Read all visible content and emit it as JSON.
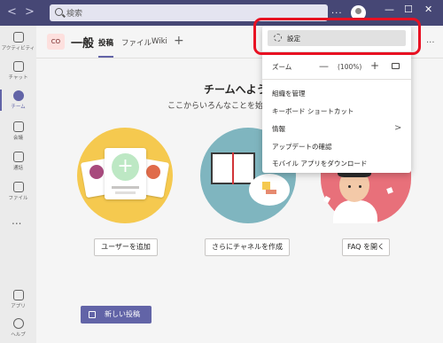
{
  "titlebar": {
    "back": "<",
    "forward": ">",
    "search_placeholder": "検索",
    "more": "...",
    "window_minimize": "—",
    "window_maximize": "☐",
    "window_close": "✕"
  },
  "rail": {
    "items": [
      {
        "label": "アクティビティ",
        "icon": "bell-icon"
      },
      {
        "label": "チャット",
        "icon": "chat-icon"
      },
      {
        "label": "チーム",
        "icon": "teams-icon"
      },
      {
        "label": "会議",
        "icon": "calendar-icon"
      },
      {
        "label": "通話",
        "icon": "phone-icon"
      },
      {
        "label": "ファイル",
        "icon": "file-icon"
      }
    ],
    "more": "...",
    "apps_label": "アプリ",
    "help_label": "ヘルプ"
  },
  "header": {
    "team_initials": "CO",
    "channel_name": "一般",
    "tabs": [
      "投稿",
      "ファイル",
      "Wiki"
    ],
    "add_tab": "+",
    "more": "..."
  },
  "main": {
    "welcome_title": "チームへようこ",
    "welcome_sub": "ここからいろんなことを始め",
    "buttons": {
      "add_user": "ユーザーを追加",
      "create_channel": "さらにチャネルを作成",
      "faq": "FAQ を開く"
    },
    "new_post": "新しい投稿"
  },
  "menu": {
    "settings": "設定",
    "zoom_label": "ズーム",
    "zoom_minus": "—",
    "zoom_level": "(100%)",
    "zoom_plus": "+",
    "items": [
      "組織を管理",
      "キーボード ショートカット",
      "情報",
      "アップデートの確認",
      "モバイル アプリをダウンロード"
    ],
    "info_chevron": ">"
  },
  "colors": {
    "titlebar": "#464775",
    "accent": "#6264a7",
    "highlight": "#e81123"
  }
}
